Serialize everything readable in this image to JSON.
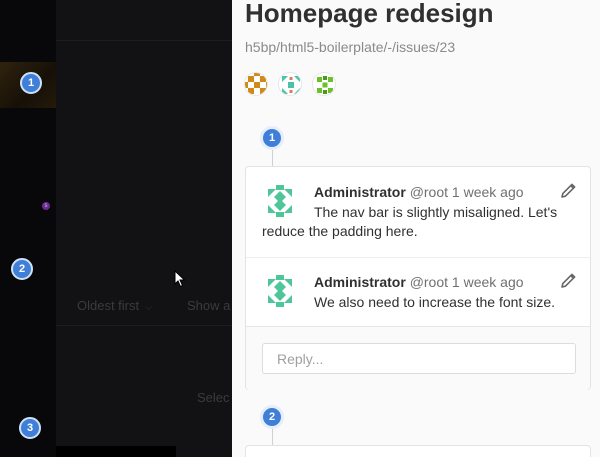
{
  "background": {
    "sort_label": "Oldest first",
    "show_label": "Show a",
    "select_label": "Selec",
    "badge": "s",
    "markers": [
      "1",
      "2",
      "3"
    ]
  },
  "panel": {
    "title": "Homepage redesign",
    "path": "h5bp/html5-boilerplate/-/issues/23",
    "participants": [
      "orange-identicon",
      "teal-identicon",
      "green-identicon"
    ],
    "steps": [
      "1",
      "2"
    ],
    "notes": [
      {
        "author": "Administrator",
        "handle": "@root",
        "time": "1 week ago",
        "body": "The nav bar is slightly misaligned. Let's reduce the padding here."
      },
      {
        "author": "Administrator",
        "handle": "@root",
        "time": "1 week ago",
        "body": "We also need to increase the font size."
      }
    ],
    "reply_placeholder": "Reply..."
  },
  "colors": {
    "accent": "#3f7fd8",
    "overlay": "#121214",
    "panel_bg": "#fafafa"
  }
}
